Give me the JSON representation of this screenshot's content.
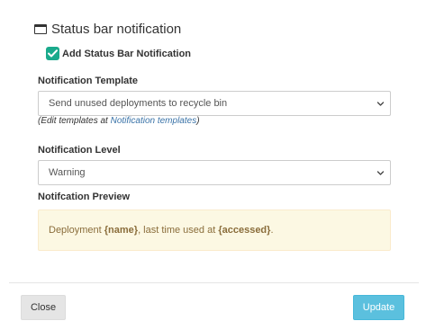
{
  "section": {
    "title": "Status bar notification",
    "icon": "window-icon"
  },
  "add_notification": {
    "label": "Add Status Bar Notification",
    "checked": true,
    "color": "#1aaa8c"
  },
  "template": {
    "label": "Notification Template",
    "selected": "Send unused deployments to recycle bin",
    "help_prefix": "(Edit templates at ",
    "help_link": "Notification templates",
    "help_suffix": ")"
  },
  "level": {
    "label": "Notification Level",
    "selected": "Warning"
  },
  "preview": {
    "label": "Notifcation Preview",
    "text_1": "Deployment ",
    "var_1": "{name}",
    "text_2": ", last time used at ",
    "var_2": "{accessed}",
    "text_3": "."
  },
  "footer": {
    "close_label": "Close",
    "update_label": "Update",
    "update_color": "#5bc0de"
  }
}
